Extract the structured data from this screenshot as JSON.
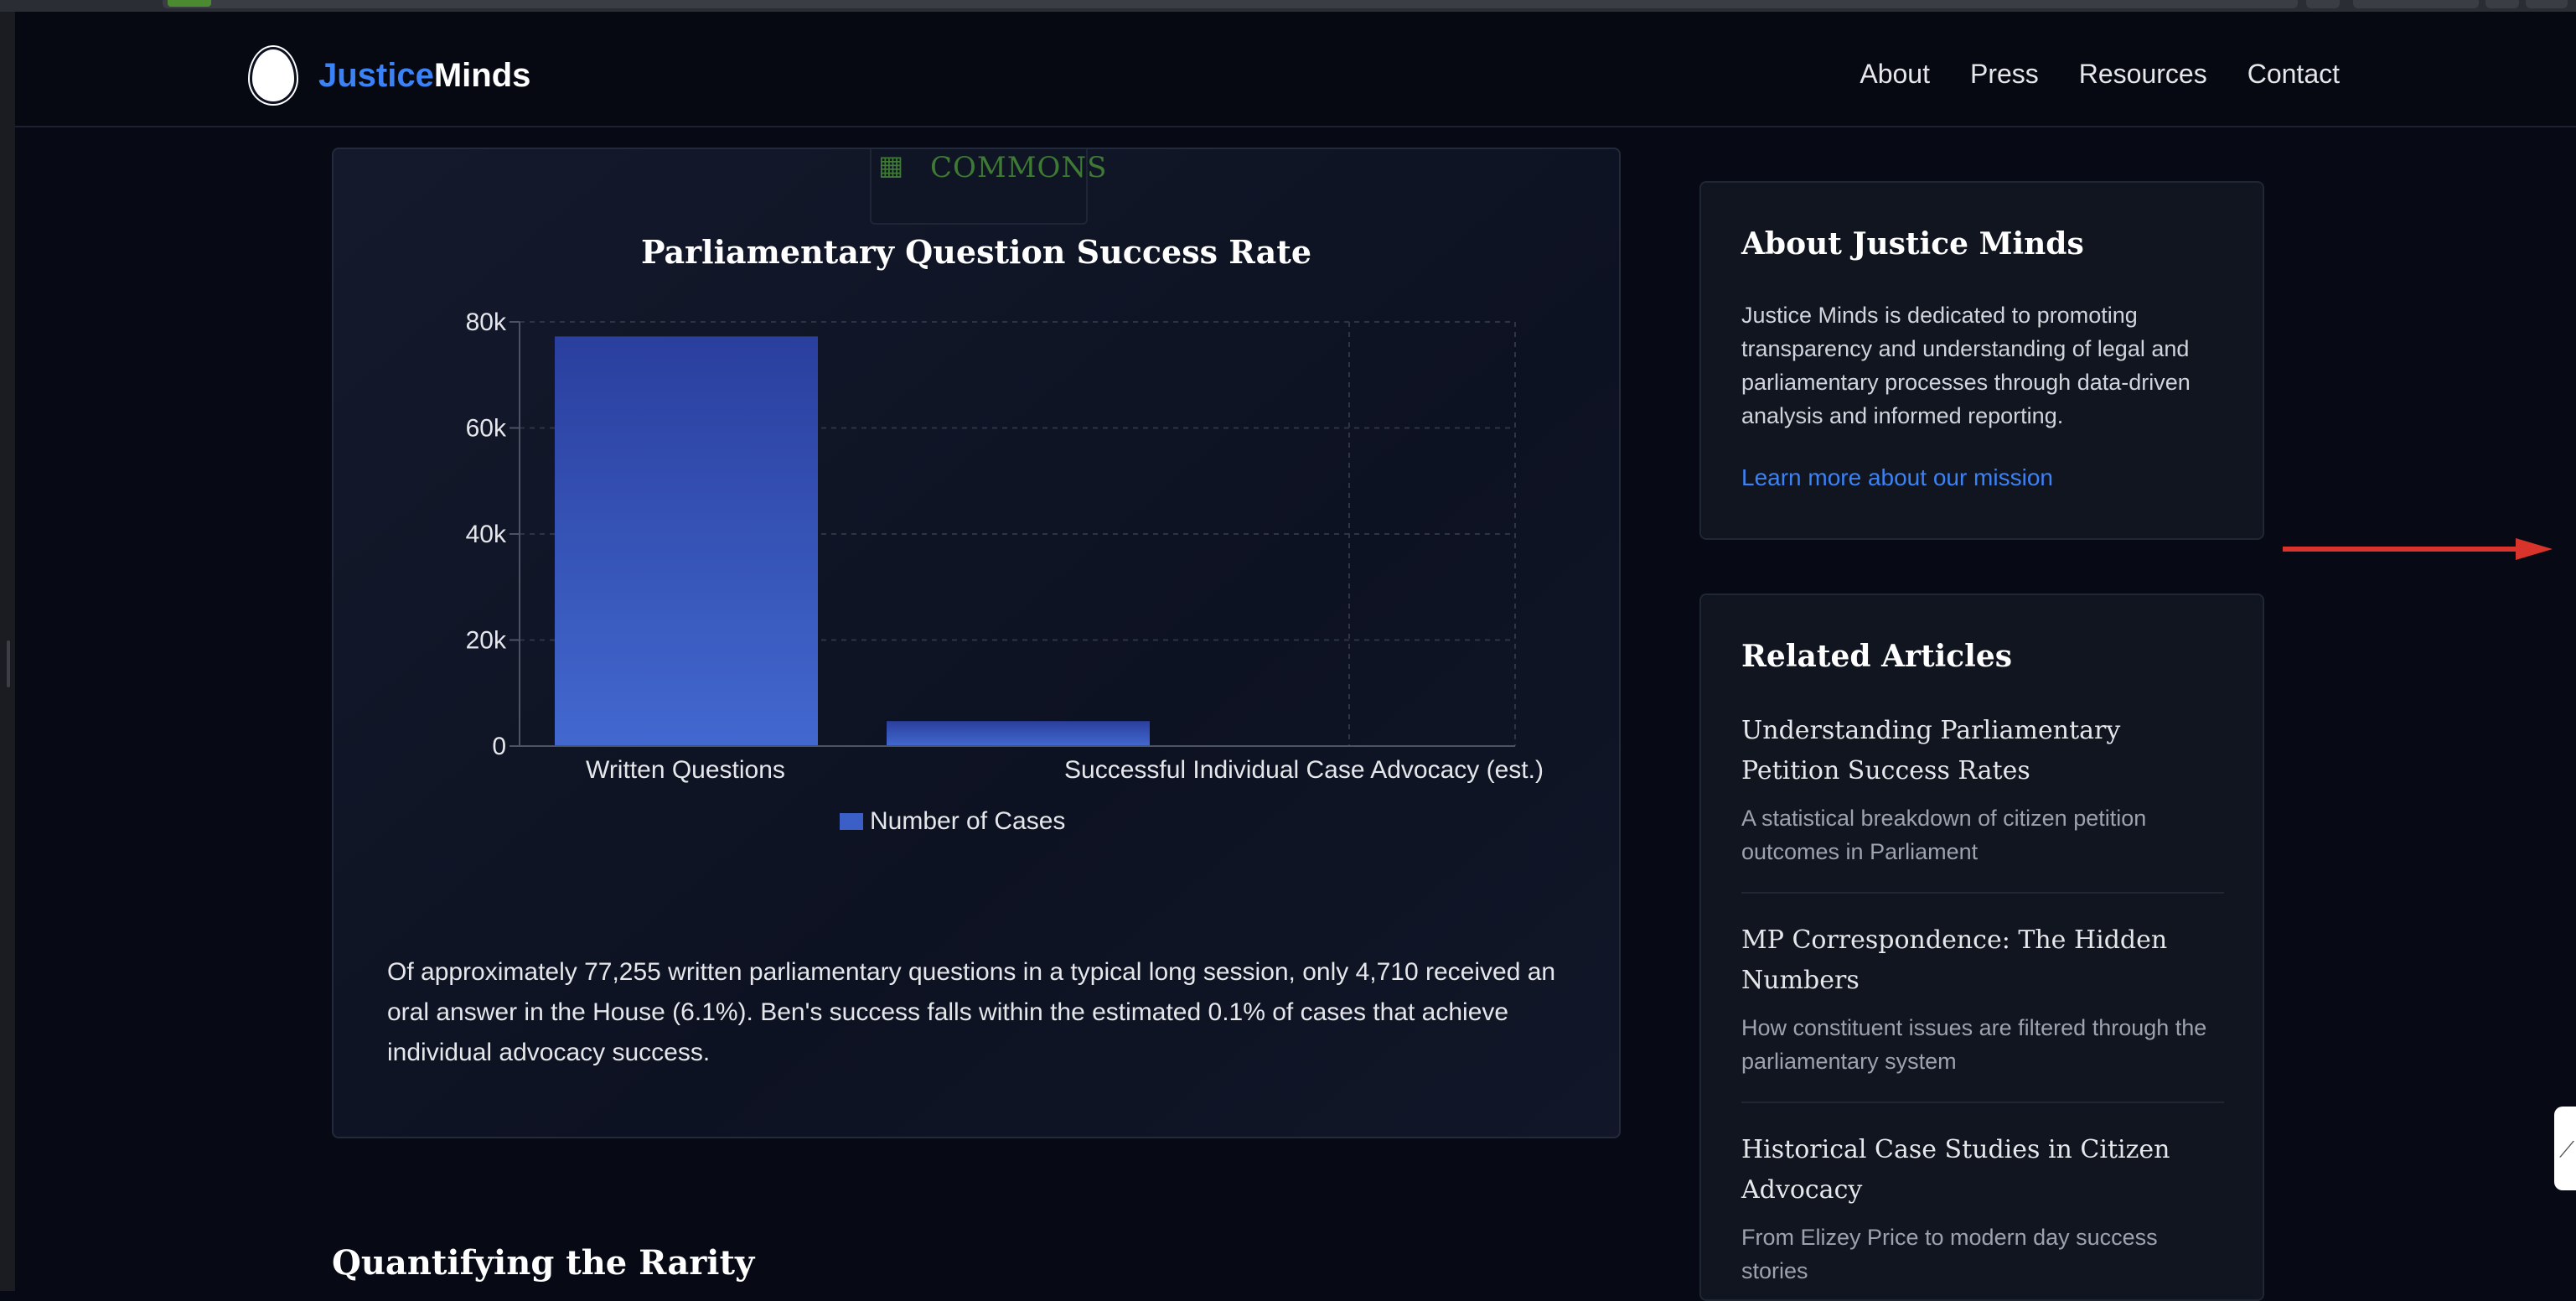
{
  "nav": {
    "logo_part1": "Justice",
    "logo_part2": "Minds",
    "links": [
      "About",
      "Press",
      "Resources",
      "Contact"
    ]
  },
  "chart_card": {
    "badge_text": "COMMONS",
    "description": "Of approximately 77,255 written parliamentary questions in a typical long session, only 4,710 received an oral answer in the House (6.1%). Ben's success falls within the estimated 0.1% of cases that achieve individual advocacy success."
  },
  "chart_data": {
    "type": "bar",
    "title": "Parliamentary Question Success Rate",
    "categories": [
      "Written Questions",
      "",
      "Successful Individual Case Advocacy (est.)"
    ],
    "series": [
      {
        "name": "Number of Cases",
        "values": [
          77255,
          4710,
          0
        ]
      }
    ],
    "yticks": [
      "0",
      "20k",
      "40k",
      "60k",
      "80k"
    ],
    "ylim": [
      0,
      80000
    ],
    "grid": true,
    "legend_position": "bottom-center",
    "bar_color": "#3b5fc7"
  },
  "section_heading": "Quantifying the Rarity",
  "about": {
    "title": "About Justice Minds",
    "text": "Justice Minds is dedicated to promoting transparency and understanding of legal and parliamentary processes through data-driven analysis and informed reporting.",
    "link": "Learn more about our mission"
  },
  "related": {
    "title": "Related Articles",
    "articles": [
      {
        "title": "Understanding Parliamentary Petition Success Rates",
        "desc": "A statistical breakdown of citizen petition outcomes in Parliament"
      },
      {
        "title": "MP Correspondence: The Hidden Numbers",
        "desc": "How constituent issues are filtered through the parliamentary system"
      },
      {
        "title": "Historical Case Studies in Citizen Advocacy",
        "desc": "From Elizey Price to modern day success stories"
      }
    ]
  },
  "colors": {
    "accent": "#3b82f6",
    "annotation_arrow": "#d9342b"
  }
}
